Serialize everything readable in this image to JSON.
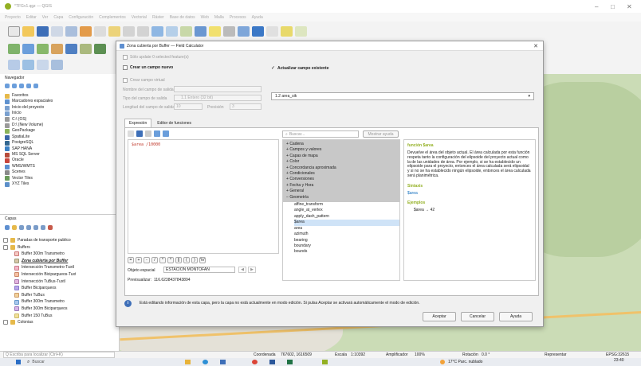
{
  "app": {
    "title": "*TFGv1.qgz — QGIS",
    "menu": [
      "Proyecto",
      "Editar",
      "Ver",
      "Capa",
      "Configuración",
      "Complementos",
      "Vectorial",
      "Ráster",
      "Base de datos",
      "Web",
      "Malla",
      "Procesos",
      "Ayuda"
    ]
  },
  "browser": {
    "title": "Navegador",
    "items": [
      "Favoritos",
      "Marcadores espaciales",
      "Inicio del proyecto",
      "Inicio",
      "C:\\ (OS)",
      "D:\\ (New Volume)",
      "GeoPackage",
      "SpatiaLite",
      "PostgreSQL",
      "SAP HANA",
      "MS SQL Server",
      "Oracle",
      "WMS/WMTS",
      "Scenes",
      "Vector Tiles",
      "XYZ Tiles"
    ]
  },
  "layers": {
    "title": "Capas",
    "items": [
      "Paradas de transporte publico",
      "Buffers",
      "Buffer 300m Transmetro",
      "Zona cubierta por Buffer",
      "Intersección Transmetro-Tuxtl",
      "Intersección Bicipargueos-Tuxt",
      "Intersección TuBus-Tuxtl",
      "Buffer Biciparqueos",
      "Buffer TuBus",
      "Buffer 300m Transmetro",
      "Buffer 300m Biciparqueos",
      "Buffer 150 TuBus",
      "Colonias"
    ]
  },
  "dialog": {
    "title": "Zona cubierta por Buffer — Field Calculator",
    "only_selected": "Sólo update 0 selected feature(s)",
    "create_new": "Crear un campo nuevo",
    "update_existing": "Actualizar campo existente",
    "virtual_field": "Crear campo virtual",
    "name_label": "Nombre del campo de salida",
    "type_label": "Tipo del campo de salida",
    "type_value": "1.1 Entero (32 bit)",
    "length_label": "Longitud del campo de salida",
    "length_value": "10",
    "precision_label": "Precisión",
    "precision_value": "3",
    "field_select": "1.2 area_sik",
    "tab_expression": "Expresión",
    "tab_functions": "Editor de funciones",
    "expression": "$area /10000",
    "operators": [
      "=",
      "+",
      "-",
      "/",
      "*",
      "^",
      "||",
      "(",
      ")",
      "'\\n'"
    ],
    "feature_label": "Objeto espacial",
    "feature_value": "ESTACIÓN MONTOFAN",
    "preview_label": "Previsualizar:",
    "preview_value": "116.6238437843894",
    "search_placeholder": "Buscar...",
    "show_help": "Mostrar ayuda",
    "groups": [
      "Cadena",
      "Campos y valores",
      "Capas de mapa",
      "Color",
      "Concordancia aproximada",
      "Condicionales",
      "Conversiones",
      "Fecha y Hora",
      "General",
      "Geometría"
    ],
    "geometry_items": [
      "affine_transform",
      "angle_at_vertex",
      "apply_dash_pattern",
      "$area",
      "area",
      "azimuth",
      "bearing",
      "boundary",
      "bounds"
    ],
    "help_title": "función $area",
    "help_text": "Devuelve el área del objeto actual. El área calculada por esta función respeta tanto la configuración del elipsoide del proyecto actual como la de las unidades de área. Por ejemplo, si se ha establecido un elipsoide para el proyecto, entonces el área calculada será elipsoidal y si no se ha establecido ningún elipsoide, entonces el área calculada será planimétrica.",
    "syntax_label": "Sintaxis",
    "syntax_value": "$area",
    "examples_label": "Ejemplos",
    "example_value": "$area → 42",
    "info_text": "Está editando información de esta capa, pero la capa no está actualmente en modo edición. Si pulsa Aceptar se activará automáticamente el modo de edición.",
    "accept": "Aceptar",
    "cancel": "Cancelar",
    "help": "Ayuda"
  },
  "statusbar": {
    "locator": "Q  Escriba para localizar (Ctrl+K)",
    "coord_label": "Coordenada",
    "coord_value": "767602, 1616509",
    "scale_label": "Escala",
    "scale_value": "1:10392",
    "magnifier_label": "Amplificador",
    "magnifier_value": "100%",
    "rotation_label": "Rotación",
    "rotation_value": "0.0 °",
    "render": "Representar",
    "crs": "EPSG:32615"
  },
  "taskbar": {
    "search": "Buscar",
    "weather": "17°C Parc. nublado",
    "time": "23:40",
    "date": "25/10/2024"
  },
  "colors": {
    "accent": "#0f6cbd",
    "selection": "#cfe3f7",
    "group_bg": "#c8c8c8",
    "map_green": "#cbdcb6"
  }
}
